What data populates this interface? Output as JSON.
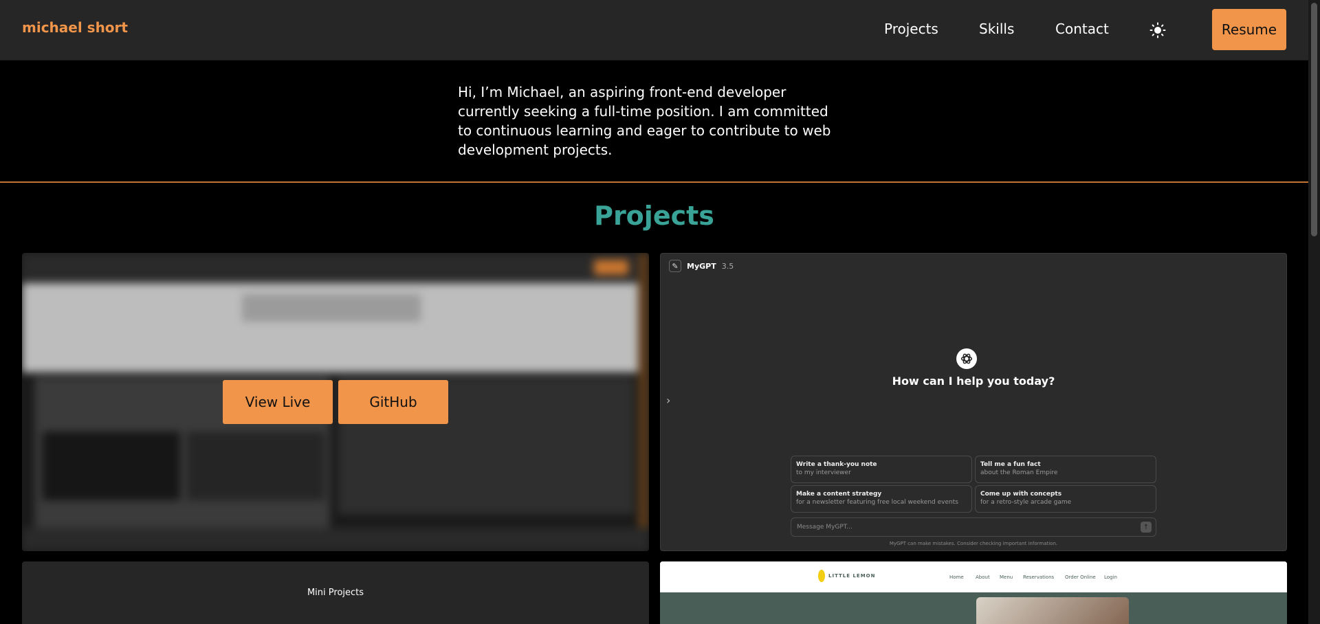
{
  "header": {
    "brand": "michael short",
    "nav": [
      "Projects",
      "Skills",
      "Contact"
    ],
    "theme_icon": "sun-icon",
    "resume_label": "Resume"
  },
  "intro": {
    "text": "Hi, I’m Michael, an aspiring front-end developer currently seeking a full-time position. I am committed to continuous learning and eager to contribute to web development projects."
  },
  "projects": {
    "heading": "Projects",
    "card1": {
      "view_live": "View Live",
      "github": "GitHub"
    },
    "mygpt": {
      "title": "MyGPT",
      "version": "3.5",
      "question": "How can I help you today?",
      "suggestions": [
        {
          "title": "Write a thank-you note",
          "subtitle": "to my interviewer"
        },
        {
          "title": "Tell me a fun fact",
          "subtitle": "about the Roman Empire"
        },
        {
          "title": "Make a content strategy",
          "subtitle": "for a newsletter featuring free local weekend events"
        },
        {
          "title": "Come up with concepts",
          "subtitle": "for a retro-style arcade game"
        }
      ],
      "input_placeholder": "Message MyGPT...",
      "disclaimer": "MyGPT can make mistakes. Consider checking important information."
    },
    "mini_projects_label": "Mini Projects",
    "little_lemon": {
      "logo_text": "LITTLE LEMON",
      "nav": [
        "Home",
        "About",
        "Menu",
        "Reservations",
        "Order Online",
        "Login"
      ]
    }
  },
  "colors": {
    "accent": "#f0954a",
    "heading": "#3aa397",
    "header_bg": "#262626",
    "page_bg": "#000000"
  }
}
